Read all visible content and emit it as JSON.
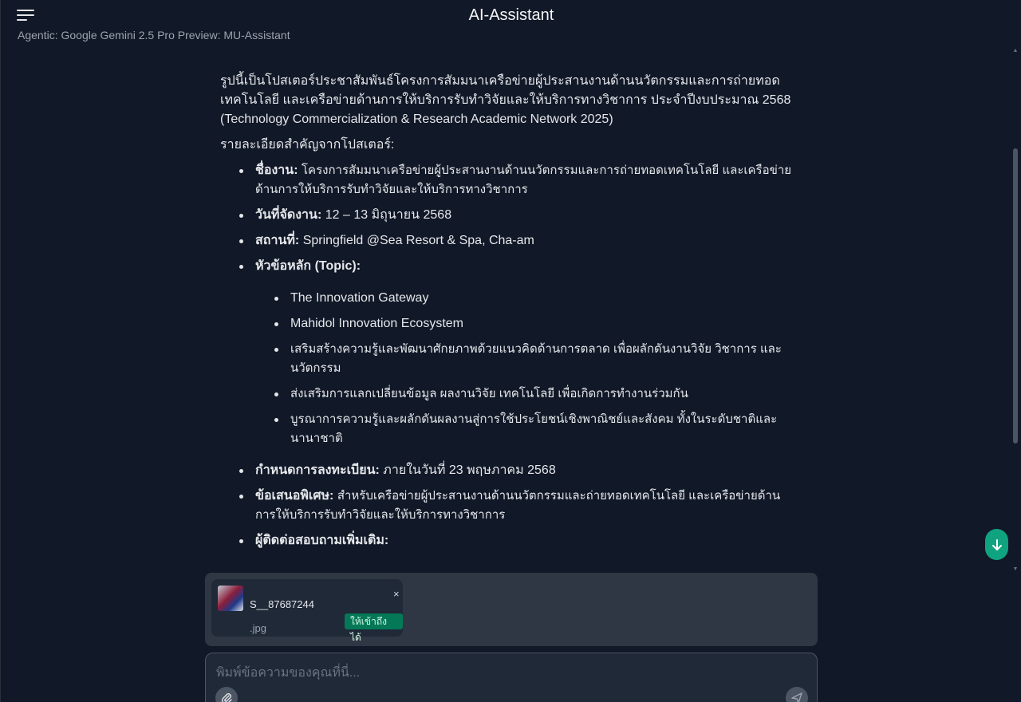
{
  "header": {
    "title": "AI-Assistant",
    "subtitle": "Agentic: Google Gemini 2.5 Pro Preview: MU-Assistant"
  },
  "message": {
    "intro": "รูปนี้เป็นโปสเตอร์ประชาสัมพันธ์โครงการสัมมนาเครือข่ายผู้ประสานงานด้านนวัตกรรมและการถ่ายทอดเทคโนโลยี และเครือข่ายด้านการให้บริการรับทำวิจัยและให้บริการทางวิชาการ ประจำปีงบประมาณ 2568 (Technology Commercialization & Research Academic Network 2025)",
    "details_heading": "รายละเอียดสำคัญจากโปสเตอร์:",
    "items": [
      {
        "label": "ชื่องาน:",
        "value": "โครงการสัมมนาเครือข่ายผู้ประสานงานด้านนวัตกรรมและการถ่ายทอดเทคโนโลยี และเครือข่ายด้านการให้บริการรับทำวิจัยและให้บริการทางวิชาการ"
      },
      {
        "label": "วันที่จัดงาน:",
        "value": "12 – 13 มิถุนายน 2568"
      },
      {
        "label": "สถานที่:",
        "value": "Springfield @Sea Resort & Spa, Cha-am"
      },
      {
        "label": "หัวข้อหลัก (Topic):",
        "value": ""
      }
    ],
    "topics": [
      "The Innovation Gateway",
      "Mahidol Innovation Ecosystem",
      "เสริมสร้างความรู้และพัฒนาศักยภาพด้วยแนวคิดด้านการตลาด เพื่อผลักดันงานวิจัย วิชาการ และนวัตกรรม",
      "ส่งเสริมการแลกเปลี่ยนข้อมูล ผลงานวิจัย เทคโนโลยี เพื่อเกิดการทำงานร่วมกัน",
      "บูรณาการความรู้และผลักดันผลงานสู่การใช้ประโยชน์เชิงพาณิชย์และสังคม ทั้งในระดับชาติและนานาชาติ"
    ],
    "items_after": [
      {
        "label": "กำหนดการลงทะเบียน:",
        "value": "ภายในวันที่ 23 พฤษภาคม 2568"
      },
      {
        "label": "ข้อเสนอพิเศษ:",
        "value": "สำหรับเครือข่ายผู้ประสานงานด้านนวัตกรรมและถ่ายทอดเทคโนโลยี และเครือข่ายด้านการให้บริการรับทำวิจัยและให้บริการทางวิชาการ"
      },
      {
        "label": "ผู้ติดต่อสอบถามเพิ่มเติม:",
        "value": ""
      }
    ]
  },
  "attachment": {
    "name": "S__87687244",
    "ext": ".jpg",
    "badge": "ให้เข้าถึงได้",
    "close": "×"
  },
  "composer": {
    "placeholder": "พิมพ์ข้อความของคุณที่นี่..."
  },
  "colors": {
    "background": "#111827",
    "accent": "#10a37f",
    "badge": "#047857"
  },
  "icons": [
    "menu-icon",
    "arrow-down-icon",
    "close-icon",
    "paperclip-icon",
    "send-icon"
  ]
}
